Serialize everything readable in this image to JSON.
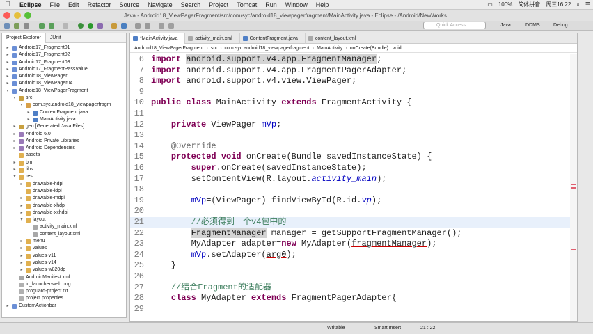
{
  "menubar": {
    "apple_icon": "apple-logo",
    "items": [
      "Eclipse",
      "File",
      "Edit",
      "Refactor",
      "Source",
      "Navigate",
      "Search",
      "Project",
      "Tomcat",
      "Run",
      "Window",
      "Help"
    ],
    "battery": "100%",
    "input_method": "简体拼音",
    "datetime": "周三16:22"
  },
  "window": {
    "title": "Java - Android18_ViewPagerFragment/src/com/syc/android18_viewpagerfragment/MainActivity.java - Eclipse - /Android/NewWorks"
  },
  "toolbar": {
    "quick_access_placeholder": "Quick Access",
    "perspectives": [
      "Java",
      "DDMS",
      "Debug"
    ]
  },
  "left_panel": {
    "tabs": [
      "Project Explorer",
      "JUnit"
    ],
    "tree": [
      {
        "label": "Android17_Fragment01",
        "depth": 0,
        "arrow": "▸",
        "icon": "project"
      },
      {
        "label": "Android17_Fragment02",
        "depth": 0,
        "arrow": "▸",
        "icon": "project"
      },
      {
        "label": "Android17_Fragment03",
        "depth": 0,
        "arrow": "▸",
        "icon": "project"
      },
      {
        "label": "Android17_FragmentPassValue",
        "depth": 0,
        "arrow": "▸",
        "icon": "project"
      },
      {
        "label": "Android18_ViewPager",
        "depth": 0,
        "arrow": "▸",
        "icon": "project"
      },
      {
        "label": "Android18_ViewPager04",
        "depth": 0,
        "arrow": "▸",
        "icon": "project"
      },
      {
        "label": "Android18_ViewPagerFragment",
        "depth": 0,
        "arrow": "▾",
        "icon": "project"
      },
      {
        "label": "src",
        "depth": 1,
        "arrow": "▾",
        "icon": "src"
      },
      {
        "label": "com.syc.android18_viewpagerfragm",
        "depth": 2,
        "arrow": "▾",
        "icon": "package"
      },
      {
        "label": "ContentFragment.java",
        "depth": 3,
        "arrow": "▸",
        "icon": "java"
      },
      {
        "label": "MainActivity.java",
        "depth": 3,
        "arrow": "▸",
        "icon": "java"
      },
      {
        "label": "gen [Generated Java Files]",
        "depth": 1,
        "arrow": "▸",
        "icon": "src"
      },
      {
        "label": "Android 6.0",
        "depth": 1,
        "arrow": "▸",
        "icon": "lib"
      },
      {
        "label": "Android Private Libraries",
        "depth": 1,
        "arrow": "▸",
        "icon": "lib"
      },
      {
        "label": "Android Dependencies",
        "depth": 1,
        "arrow": "▸",
        "icon": "lib"
      },
      {
        "label": "assets",
        "depth": 1,
        "arrow": "",
        "icon": "folder"
      },
      {
        "label": "bin",
        "depth": 1,
        "arrow": "▸",
        "icon": "folder"
      },
      {
        "label": "libs",
        "depth": 1,
        "arrow": "▸",
        "icon": "folder"
      },
      {
        "label": "res",
        "depth": 1,
        "arrow": "▾",
        "icon": "folder"
      },
      {
        "label": "drawable-hdpi",
        "depth": 2,
        "arrow": "▸",
        "icon": "folder"
      },
      {
        "label": "drawable-ldpi",
        "depth": 2,
        "arrow": "",
        "icon": "folder"
      },
      {
        "label": "drawable-mdpi",
        "depth": 2,
        "arrow": "▸",
        "icon": "folder"
      },
      {
        "label": "drawable-xhdpi",
        "depth": 2,
        "arrow": "▸",
        "icon": "folder"
      },
      {
        "label": "drawable-xxhdpi",
        "depth": 2,
        "arrow": "▸",
        "icon": "folder"
      },
      {
        "label": "layout",
        "depth": 2,
        "arrow": "▾",
        "icon": "folder"
      },
      {
        "label": "activity_main.xml",
        "depth": 3,
        "arrow": "",
        "icon": "xml"
      },
      {
        "label": "content_layout.xml",
        "depth": 3,
        "arrow": "",
        "icon": "xml"
      },
      {
        "label": "menu",
        "depth": 2,
        "arrow": "▸",
        "icon": "folder"
      },
      {
        "label": "values",
        "depth": 2,
        "arrow": "▸",
        "icon": "folder"
      },
      {
        "label": "values-v11",
        "depth": 2,
        "arrow": "▸",
        "icon": "folder"
      },
      {
        "label": "values-v14",
        "depth": 2,
        "arrow": "▸",
        "icon": "folder"
      },
      {
        "label": "values-w820dp",
        "depth": 2,
        "arrow": "▸",
        "icon": "folder"
      },
      {
        "label": "AndroidManifest.xml",
        "depth": 1,
        "arrow": "",
        "icon": "xml"
      },
      {
        "label": "ic_launcher-web.png",
        "depth": 1,
        "arrow": "",
        "icon": "file"
      },
      {
        "label": "proguard-project.txt",
        "depth": 1,
        "arrow": "",
        "icon": "file"
      },
      {
        "label": "project.properties",
        "depth": 1,
        "arrow": "",
        "icon": "file"
      },
      {
        "label": "CustomActionbar",
        "depth": 0,
        "arrow": "▸",
        "icon": "project"
      }
    ]
  },
  "editor": {
    "tabs": [
      {
        "label": "*MainActivity.java",
        "active": true,
        "icon": "java"
      },
      {
        "label": "activity_main.xml",
        "active": false,
        "icon": "xml"
      },
      {
        "label": "ContentFragment.java",
        "active": false,
        "icon": "java"
      },
      {
        "label": "content_layout.xml",
        "active": false,
        "icon": "xml"
      }
    ],
    "breadcrumb": [
      "Android18_ViewPagerFragment",
      "src",
      "com.syc.android18_viewpagerfragment",
      "MainActivity",
      "onCreate(Bundle) : void"
    ],
    "lines": [
      {
        "n": "6",
        "segs": [
          [
            "kw",
            "import"
          ],
          [
            "t",
            " "
          ],
          [
            "hl",
            "android.support.v4.app.FragmentManager"
          ],
          [
            "t",
            ";"
          ]
        ]
      },
      {
        "n": "7",
        "segs": [
          [
            "kw",
            "import"
          ],
          [
            "t",
            " android.support.v4.app.FragmentPagerAdapter;"
          ]
        ]
      },
      {
        "n": "8",
        "segs": [
          [
            "kw",
            "import"
          ],
          [
            "t",
            " android.support.v4.view.ViewPager;"
          ]
        ]
      },
      {
        "n": "9",
        "segs": []
      },
      {
        "n": "10",
        "segs": [
          [
            "kw",
            "public"
          ],
          [
            "t",
            " "
          ],
          [
            "kw",
            "class"
          ],
          [
            "t",
            " MainActivity "
          ],
          [
            "kw",
            "extends"
          ],
          [
            "t",
            " FragmentActivity {"
          ]
        ]
      },
      {
        "n": "11",
        "segs": []
      },
      {
        "n": "12",
        "segs": [
          [
            "t",
            "    "
          ],
          [
            "kw",
            "private"
          ],
          [
            "t",
            " ViewPager "
          ],
          [
            "fl",
            "mVp"
          ],
          [
            "t",
            ";"
          ]
        ]
      },
      {
        "n": "13",
        "segs": []
      },
      {
        "n": "14",
        "segs": [
          [
            "t",
            "    "
          ],
          [
            "an",
            "@Override"
          ]
        ]
      },
      {
        "n": "15",
        "segs": [
          [
            "t",
            "    "
          ],
          [
            "kw",
            "protected"
          ],
          [
            "t",
            " "
          ],
          [
            "kw",
            "void"
          ],
          [
            "t",
            " onCreate(Bundle savedInstanceState) {"
          ]
        ]
      },
      {
        "n": "16",
        "segs": [
          [
            "t",
            "        "
          ],
          [
            "kw",
            "super"
          ],
          [
            "t",
            ".onCreate(savedInstanceState);"
          ]
        ]
      },
      {
        "n": "17",
        "segs": [
          [
            "t",
            "        setContentView(R.layout."
          ],
          [
            "it",
            "activity_main"
          ],
          [
            "t",
            ");"
          ]
        ]
      },
      {
        "n": "18",
        "segs": []
      },
      {
        "n": "19",
        "segs": [
          [
            "t",
            "        "
          ],
          [
            "fl",
            "mVp"
          ],
          [
            "t",
            "=(ViewPager) findViewById(R.id."
          ],
          [
            "it",
            "vp"
          ],
          [
            "t",
            ");"
          ]
        ]
      },
      {
        "n": "20",
        "segs": []
      },
      {
        "n": "21",
        "segs": [
          [
            "t",
            "        "
          ],
          [
            "cm",
            "//必须得到一个v4包中的"
          ]
        ]
      },
      {
        "n": "22",
        "segs": [
          [
            "t",
            "        "
          ],
          [
            "hl",
            "FragmentManager"
          ],
          [
            "t",
            " manager = getSupportFragmentManager();"
          ]
        ]
      },
      {
        "n": "23",
        "segs": [
          [
            "t",
            "        MyAdapter adapter="
          ],
          [
            "kw",
            "new"
          ],
          [
            "t",
            " MyAdapter("
          ],
          [
            "ul",
            "fragmentManager"
          ],
          [
            "t",
            ");"
          ]
        ]
      },
      {
        "n": "24",
        "segs": [
          [
            "t",
            "        "
          ],
          [
            "fl",
            "mVp"
          ],
          [
            "t",
            ".setAdapter("
          ],
          [
            "ul",
            "arg0"
          ],
          [
            "t",
            ");"
          ]
        ]
      },
      {
        "n": "25",
        "segs": [
          [
            "t",
            "    }"
          ]
        ]
      },
      {
        "n": "26",
        "segs": []
      },
      {
        "n": "27",
        "segs": [
          [
            "t",
            "    "
          ],
          [
            "cm",
            "//结合Fragment的适配器"
          ]
        ]
      },
      {
        "n": "28",
        "segs": [
          [
            "t",
            "    "
          ],
          [
            "kw",
            "class"
          ],
          [
            "t",
            " MyAdapter "
          ],
          [
            "kw",
            "extends"
          ],
          [
            "t",
            " FragmentPagerAdapter{"
          ]
        ]
      },
      {
        "n": "29",
        "segs": []
      }
    ],
    "current_line": "21"
  },
  "statusbar": {
    "mode": "Writable",
    "insert": "Smart Insert",
    "position": "21 : 22"
  },
  "colors": {
    "keyword": "#7f0055",
    "comment": "#3f7f5f",
    "field": "#0000c0",
    "selection": "#c4d8ee"
  }
}
